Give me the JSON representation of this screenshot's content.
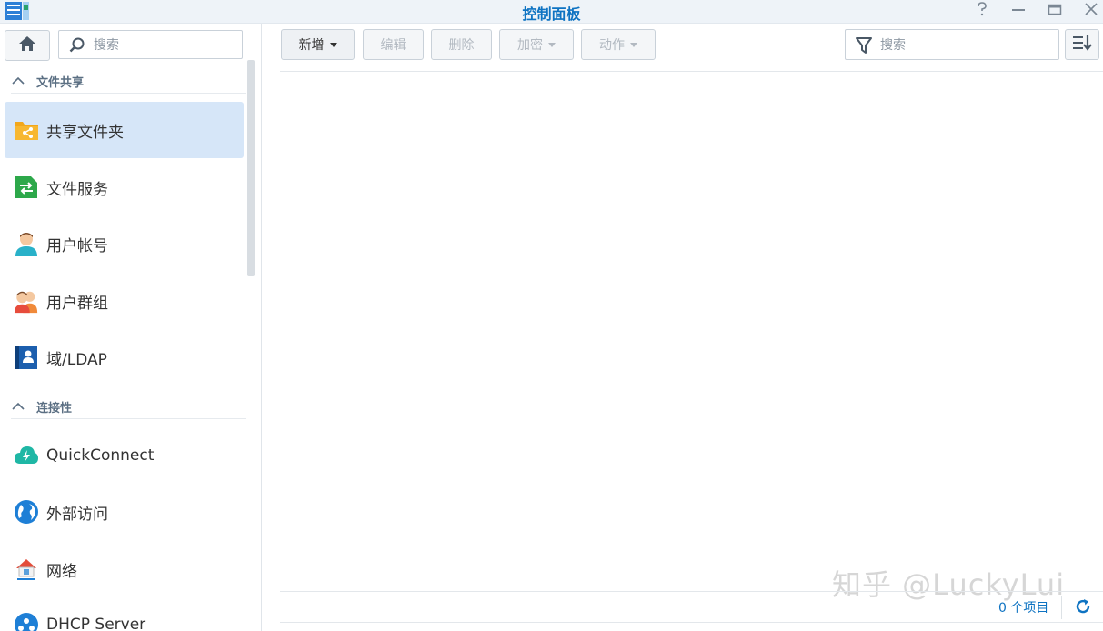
{
  "window": {
    "title": "控制面板",
    "controls": [
      "help-icon",
      "minimize-icon",
      "maximize-icon",
      "close-icon"
    ]
  },
  "sidebar": {
    "search_placeholder": "搜索",
    "sections": [
      {
        "label": "文件共享",
        "items": [
          {
            "label": "共享文件夹",
            "icon": "shared-folder-icon",
            "active": true
          },
          {
            "label": "文件服务",
            "icon": "file-services-icon"
          },
          {
            "label": "用户帐号",
            "icon": "user-icon"
          },
          {
            "label": "用户群组",
            "icon": "group-icon"
          },
          {
            "label": "域/LDAP",
            "icon": "ldap-icon"
          }
        ]
      },
      {
        "label": "连接性",
        "items": [
          {
            "label": "QuickConnect",
            "icon": "quickconnect-icon"
          },
          {
            "label": "外部访问",
            "icon": "external-access-icon"
          },
          {
            "label": "网络",
            "icon": "network-icon"
          },
          {
            "label": "DHCP Server",
            "icon": "dhcp-server-icon"
          }
        ]
      }
    ]
  },
  "toolbar": {
    "create_label": "新增",
    "edit_label": "编辑",
    "delete_label": "删除",
    "encrypt_label": "加密",
    "action_label": "动作",
    "filter_placeholder": "搜索"
  },
  "footer": {
    "item_count": "0 个项目"
  },
  "watermark": "知乎 @LuckyLui",
  "colors": {
    "accent": "#0e73c2",
    "active_bg": "#d6e6f8",
    "titlebar_bg": "#eef3f8"
  }
}
